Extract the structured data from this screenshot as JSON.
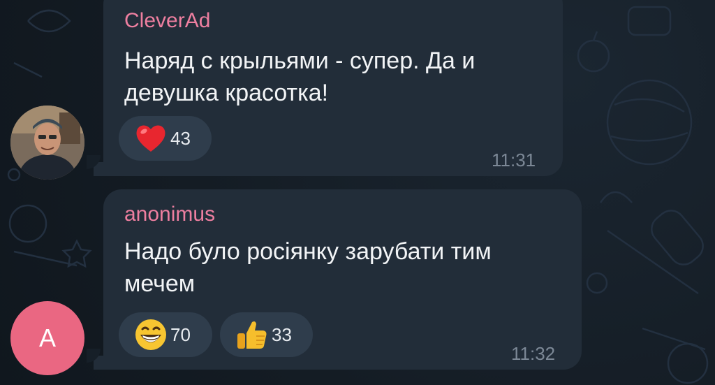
{
  "messages": [
    {
      "sender": "CleverAd",
      "text": "Наряд с крыльями - супер. Да и девушка красотка!",
      "time": "11:31",
      "reactions": [
        {
          "icon": "heart",
          "count": "43"
        }
      ]
    },
    {
      "sender": "anonimus",
      "avatar_letter": "A",
      "text": "Надо було росіянку зарубати тим мечем",
      "time": "11:32",
      "reactions": [
        {
          "icon": "grinning-face",
          "count": "70"
        },
        {
          "icon": "thumbs-up",
          "count": "33"
        }
      ]
    }
  ],
  "colors": {
    "background": "#141c24",
    "bubble": "#222d39",
    "reaction_pill": "#2f3d4c",
    "sender_name": "#ee7fa0",
    "message_text": "#f2f4f6",
    "timestamp": "#7c8896",
    "avatar_letter_bg": "#ea6782"
  }
}
